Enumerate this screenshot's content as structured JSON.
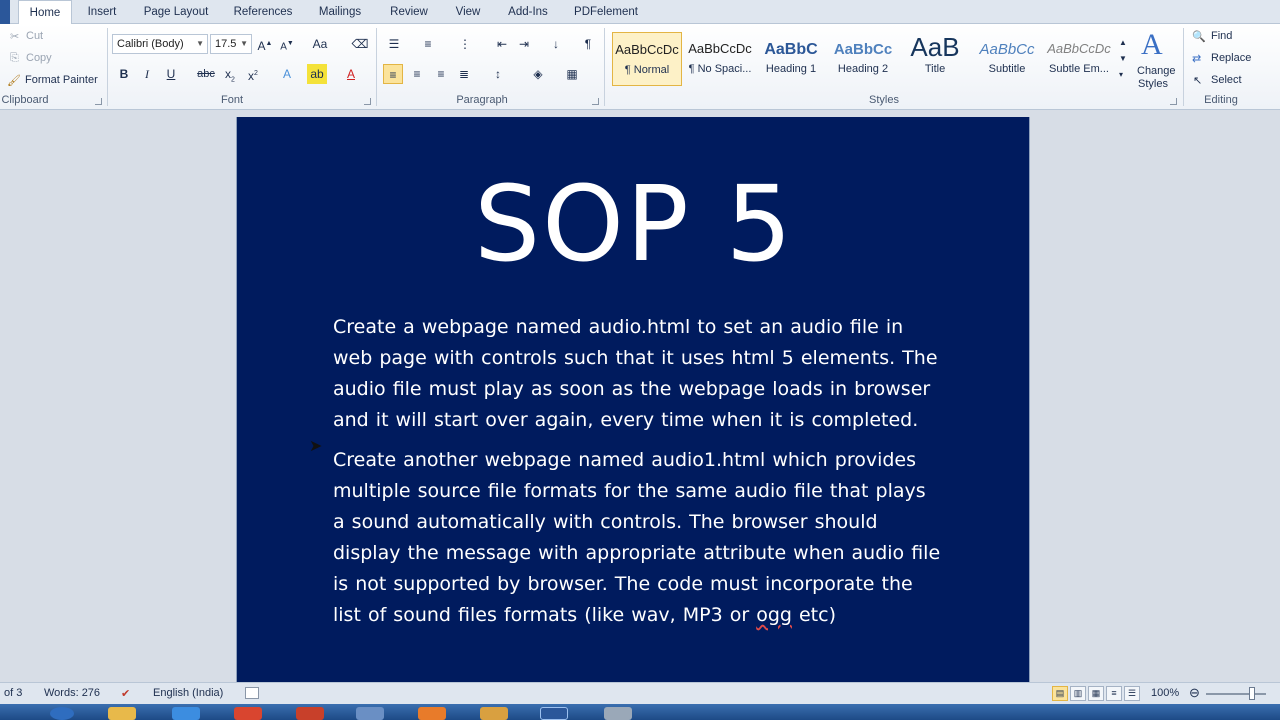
{
  "tabs": [
    "Home",
    "Insert",
    "Page Layout",
    "References",
    "Mailings",
    "Review",
    "View",
    "Add-Ins",
    "PDFelement"
  ],
  "clipboard": {
    "cut": "Cut",
    "copy": "Copy",
    "format_painter": "Format Painter",
    "label": "Clipboard"
  },
  "font": {
    "family": "Calibri (Body)",
    "size": "17.5",
    "label": "Font"
  },
  "paragraph": {
    "label": "Paragraph"
  },
  "styles": {
    "label": "Styles",
    "items": [
      {
        "preview": "AaBbCcDc",
        "name": "¶ Normal"
      },
      {
        "preview": "AaBbCcDc",
        "name": "¶ No Spaci..."
      },
      {
        "preview": "AaBbC",
        "name": "Heading 1"
      },
      {
        "preview": "AaBbCc",
        "name": "Heading 2"
      },
      {
        "preview": "AaB",
        "name": "Title"
      },
      {
        "preview": "AaBbCc",
        "name": "Subtitle"
      },
      {
        "preview": "AaBbCcDc",
        "name": "Subtle Em..."
      }
    ],
    "change_styles_1": "Change",
    "change_styles_2": "Styles"
  },
  "editing": {
    "find": "Find",
    "replace": "Replace",
    "select": "Select",
    "label": "Editing"
  },
  "document": {
    "title": "SOP 5",
    "para1": "Create a webpage named audio.html to set an audio file in web page with controls such that it uses html 5 elements. The audio file must play as soon as the webpage loads in browser and it will start over again, every time when it is completed.",
    "para2_a": "Create another webpage named audio1.html which provides multiple source file formats for the same audio file that plays a sound automatically with controls. The browser should display the message with appropriate attribute when audio file is not supported by browser. The code must incorporate the list of sound files formats (like wav, MP3 or ",
    "para2_ogg": "ogg",
    "para2_b": " etc)"
  },
  "status": {
    "page": "of 3",
    "words": "Words: 276",
    "language": "English (India)",
    "zoom": "100%"
  },
  "colors": {
    "page_bg": "#001b5e",
    "accent": "#2b579a"
  }
}
